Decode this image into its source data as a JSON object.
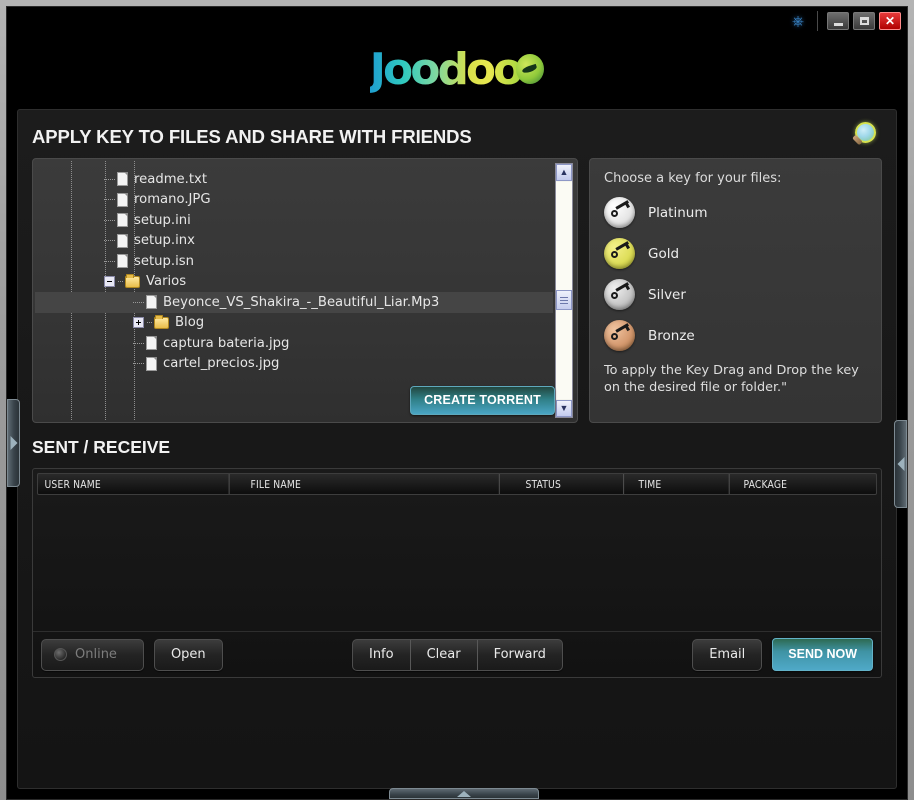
{
  "titlebar": {
    "power_icon": "power-icon",
    "minimize_label": "minimize-icon",
    "maximize_label": "maximize-icon",
    "close_label": "✕"
  },
  "logo": {
    "text": "Joodoo"
  },
  "header": {
    "title": "APPLY KEY TO FILES AND SHARE WITH FRIENDS",
    "search_icon": "search-icon"
  },
  "tree": {
    "nodes": [
      {
        "label": "readme.txt",
        "type": "file",
        "depth": 3,
        "toggle": "none",
        "selected": false
      },
      {
        "label": "romano.JPG",
        "type": "file",
        "depth": 3,
        "toggle": "none",
        "selected": false
      },
      {
        "label": "setup.ini",
        "type": "file",
        "depth": 3,
        "toggle": "none",
        "selected": false
      },
      {
        "label": "setup.inx",
        "type": "file",
        "depth": 3,
        "toggle": "none",
        "selected": false
      },
      {
        "label": "setup.isn",
        "type": "file",
        "depth": 3,
        "toggle": "none",
        "selected": false
      },
      {
        "label": "Varios",
        "type": "folder",
        "depth": 3,
        "toggle": "minus",
        "selected": false
      },
      {
        "label": "Beyonce_VS_Shakira_-_Beautiful_Liar.Mp3",
        "type": "file",
        "depth": 4,
        "toggle": "none",
        "selected": true
      },
      {
        "label": "Blog",
        "type": "folder",
        "depth": 4,
        "toggle": "plus",
        "selected": false
      },
      {
        "label": "captura bateria.jpg",
        "type": "file",
        "depth": 4,
        "toggle": "none",
        "selected": false
      },
      {
        "label": "cartel_precios.jpg",
        "type": "file",
        "depth": 4,
        "toggle": "none",
        "selected": false
      }
    ],
    "create_torrent_label": "CREATE TORRENT",
    "scroll_up_glyph": "▲",
    "scroll_down_glyph": "▼"
  },
  "keys": {
    "lead": "Choose a key for your files:",
    "items": [
      {
        "label": "Platinum",
        "color": "#e4e4e4"
      },
      {
        "label": "Gold",
        "color": "#dede5a"
      },
      {
        "label": "Silver",
        "color": "#c8c8c8"
      },
      {
        "label": "Bronze",
        "color": "#d59a70"
      }
    ],
    "hint": "To apply the Key Drag and Drop the key on the desired file or folder.\""
  },
  "sent_receive": {
    "title": "SENT / RECEIVE",
    "columns": [
      "USER NAME",
      "FILE NAME",
      "STATUS",
      "TIME",
      "PACKAGE"
    ],
    "rows": []
  },
  "toolbar": {
    "online_label": "Online",
    "open_label": "Open",
    "group": [
      "Info",
      "Clear",
      "Forward"
    ],
    "email_label": "Email",
    "send_now_label": "SEND NOW"
  },
  "edges": {
    "left_arrow": "expand-right-arrow",
    "right_arrow": "expand-left-arrow",
    "bottom_arrow": "expand-up-arrow"
  },
  "colors": {
    "accent_blue": "#4fa9c8",
    "accent_green": "#2d6a52",
    "close_red": "#e83a3a",
    "power_blue": "#3a86c8"
  }
}
